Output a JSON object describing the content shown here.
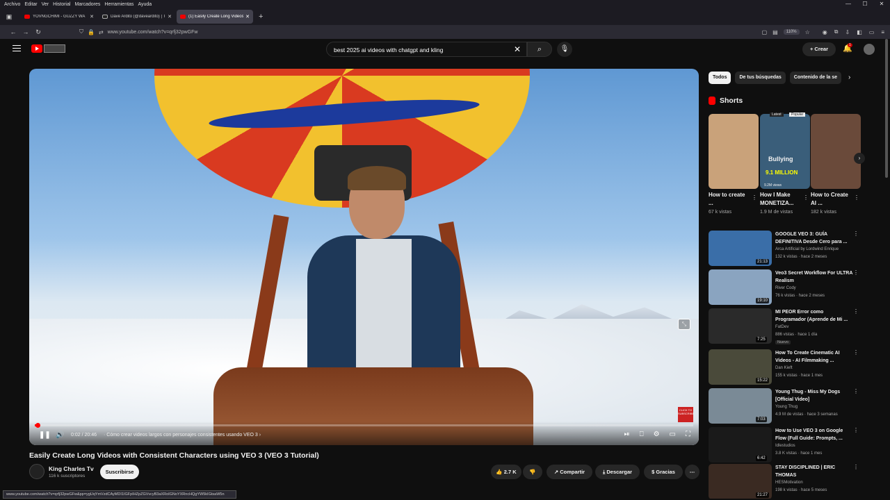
{
  "browser": {
    "menu": [
      "Archivo",
      "Editar",
      "Ver",
      "Historial",
      "Marcadores",
      "Herramientas",
      "Ayuda"
    ],
    "tabs": [
      {
        "title": "YOVNGCHIMI - GUZZY WA"
      },
      {
        "title": "Dave Ardito (@daveardito) | Tik"
      },
      {
        "title": "(1) Easily Create Long Videos"
      }
    ],
    "url": "www.youtube.com/watch?v=qrfj32pwGFw",
    "zoom": "110%",
    "status_url": "www.youtube.com/watch?v=qrfj32pwGFw&pp=ygUqYmVzdCAyMDI1IGFpIHZpZGVvcyB3aXRoIGNoYXRncHQgYW5kIGtsaW5n"
  },
  "youtube": {
    "search_query": "best 2025 ai videos with chatgpt and kling",
    "create_label": "Crear",
    "notif_count": "1"
  },
  "player": {
    "time": "0:02 / 20:46",
    "chapter": "Cómo crear videos largos con personajes consistentes usando VEO 3",
    "progress": 0.0016,
    "subscribe_stamp": "CLICK TO SUBSCRIBE"
  },
  "video": {
    "title": "Easily Create Long Videos with Consistent Characters using VEO 3 (VEO 3 Tutorial)",
    "channel": "King Charles Tv",
    "subscribers": "116 k suscriptores",
    "subscribe_label": "Suscribirse",
    "likes": "2.7 K",
    "share": "Compartir",
    "download": "Descargar",
    "thanks": "Gracias"
  },
  "sidebar": {
    "chips": [
      "Todos",
      "De tus búsquedas",
      "Contenido de la se"
    ],
    "shorts_label": "Shorts",
    "shorts": [
      {
        "title": "How to create ...",
        "views": "67 k vistas",
        "color": "#c9a27a"
      },
      {
        "title": "How I Make MONETIZA...",
        "views": "1.9 M de vistas",
        "color": "#3a5e7a"
      },
      {
        "title": "How to Create AI ...",
        "views": "182 k vistas",
        "color": "#6a4a3a"
      }
    ],
    "short_overlays": {
      "latest": "Latest",
      "popular": "Popular",
      "bullying": "Bullying",
      "million": "9.1 MILLION",
      "views_small": "9.2M views"
    },
    "recommended": [
      {
        "title": "GOOGLE VEO 3: GUÍA DEFINITIVA Desde Cero para ...",
        "channel": "Arca Artificial by Lordwind Enrique",
        "meta": "132 k vistas · hace 2 meses",
        "duration": "21:13",
        "color": "#3a6ea8"
      },
      {
        "title": "Veo3 Secret Workflow For ULTRA Realism",
        "channel": "River Cody",
        "meta": "76 k vistas · hace 2 meses",
        "duration": "19:10",
        "color": "#8aa4c0"
      },
      {
        "title": "MI PEOR Error como Programador (Aprende de Mi ...",
        "channel": "FatDev",
        "meta": "886 vistas · hace 1 día",
        "duration": "7:25",
        "color": "#2a2a2a",
        "badge": "Nuevo"
      },
      {
        "title": "How To Create Cinematic AI Videos - AI Filmmaking ...",
        "channel": "Dan Kieft",
        "meta": "155 k vistas · hace 1 mes",
        "duration": "15:22",
        "color": "#4a4a3a"
      },
      {
        "title": "Young Thug - Miss My Dogs [Official Video]",
        "channel": "Young Thug",
        "meta": "4.9 M de vistas · hace 3 semanas",
        "duration": "7:03",
        "color": "#7a8a96"
      },
      {
        "title": "How to Use VEO 3 on Google Flow (Full Guide: Prompts, ...",
        "channel": "Idlestudios",
        "meta": "3.8 K vistas · hace 1 mes",
        "duration": "6:42",
        "color": "#1a1a1a"
      },
      {
        "title": "STAY DISCIPLINED | ERIC THOMAS",
        "channel": "HESMotivation",
        "meta": "198 k vistas · hace 5 meses",
        "duration": "21:27",
        "color": "#3a2a22"
      }
    ]
  }
}
